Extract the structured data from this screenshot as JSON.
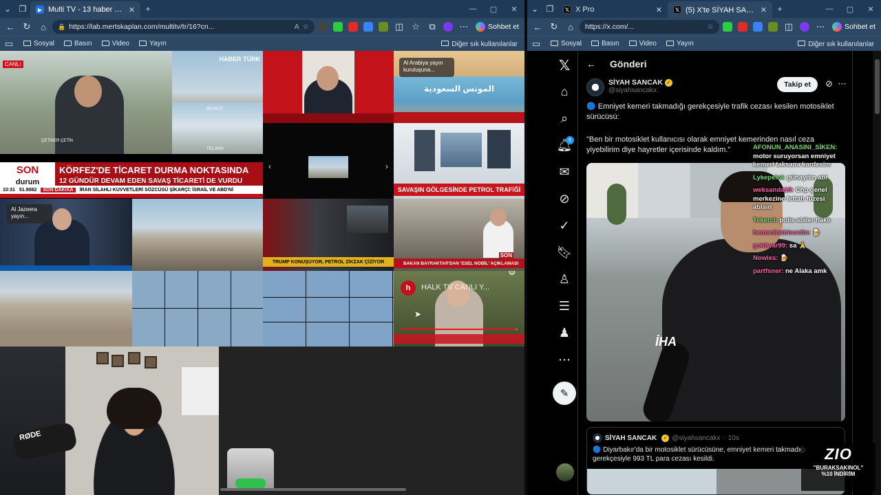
{
  "left_browser": {
    "tab_active": "Multi TV - 13 haber kanalını aynı anda",
    "url": "https://lab.mertskaplan.com/multitv/tr/16?cn...",
    "copilot": "Sohbet et",
    "bookmarks": [
      "Sosyal",
      "Basın",
      "Video",
      "Yayın"
    ],
    "other_bookmarks": "Diğer sık kullanılanlar"
  },
  "tv_grid": {
    "canli_label": "CANLI",
    "haberturk_logo": "HABER TÜRK",
    "beyrut": "BEYRUT",
    "telaviv": "TEL AVİV",
    "speaker_name": "ÇETİNER ÇETİN",
    "son_durum": [
      "SON",
      "durum"
    ],
    "headline_main": "KÖRFEZ'DE TİCARET DURMA NOKTASINDA",
    "headline_sub": "12 GÜNDÜR DEVAM EDEN SAVAŞ TİCARETİ DE VURDU",
    "ticker_time": "10:31",
    "ticker_value": "51.9082",
    "ticker_tag": "SON DAKİKA",
    "ticker_text": "İRAN SİLAHLI KUVVETLERİ SÖZCÜSÜ ŞİKARÇİ: İSRAİL VE ABD'Nİ",
    "al_arabiya_popup": "Al Arabiya yayın kuruluşuna...",
    "arabic_text": "المونس السعودية",
    "petrol_banner": "SAVAŞIN GÖLGESİNDE PETROL TRAFİĞİ",
    "al_jazeera_popup": "Al Jazeera yayın...",
    "trump_banner": "TRUMP KONUŞUYOR, PETROL ZİKZAK ÇİZİYOR",
    "bakan_banner": "BAKAN BAYRAKTAR'DAN 'ESEL NOBİL' AÇIKLAMASI",
    "son_logo": "SON",
    "halk_tv": "HALK TV CANLI Y..."
  },
  "right_browser": {
    "tabs": [
      "X Pro",
      "(5) X'te SİYAH SANCAK: \"🔵 E"
    ],
    "tab_counts": "(5)",
    "url": "https://x.com/...",
    "copilot": "Sohbet et",
    "bookmarks": [
      "Sosyal",
      "Basın",
      "Video",
      "Yayın"
    ],
    "other_bookmarks": "Diğer sık kullanılanlar"
  },
  "x_page": {
    "header": "Gönderi",
    "notification_count": "5",
    "author_name": "SİYAH SANCAK",
    "author_handle": "@siyahsancakx",
    "follow_label": "Takip et",
    "tweet_line1": "🔵 Emniyet kemeri takmadığı gerekçesiyle trafik cezası kesilen motosiklet sürücüsü:",
    "tweet_quote": "\"Ben bir motosiklet kullanıcısı olarak emniyet kemerinden nasıl ceza yiyebilirim diye hayretler içerisinde kaldım.\"",
    "iha_logo": "İHA",
    "quoted_name": "SİYAH SANCAK",
    "quoted_handle": "@siyahsancakx",
    "quoted_time": "10s",
    "quoted_text": "🔵 Diyarbakır'da bir motosiklet sürücüsüne, emniyet kemeri takmadığı gerekçesiyle 993 TL para cezası kesildi."
  },
  "stream_chat": [
    {
      "name": "AFONUN_ANASINI_SİKEN:",
      "msg": "motor suruyorsan emniyet kemeri taksana kardesim"
    },
    {
      "name": "Lykepeiol:",
      "msg": "günaydın abi"
    },
    {
      "name": "weksanda18:",
      "msg": "Chp genel merkezine fettah füzesi atılsın"
    },
    {
      "name": "Tekerci:",
      "msg": "polis abiler haklı"
    },
    {
      "name": "hemaninabiscetin:",
      "msg": "🍺"
    },
    {
      "name": "goldwar99:",
      "msg": "sa 🙏"
    },
    {
      "name": "Nowles:",
      "msg": "🍺"
    },
    {
      "name": "partfsner:",
      "msg": "ne Alaka amk"
    }
  ],
  "overlay": {
    "brand": "ZIO",
    "promo": "\"BURAKSAKINOL\"",
    "discount": "%10 İNDİRİM"
  }
}
